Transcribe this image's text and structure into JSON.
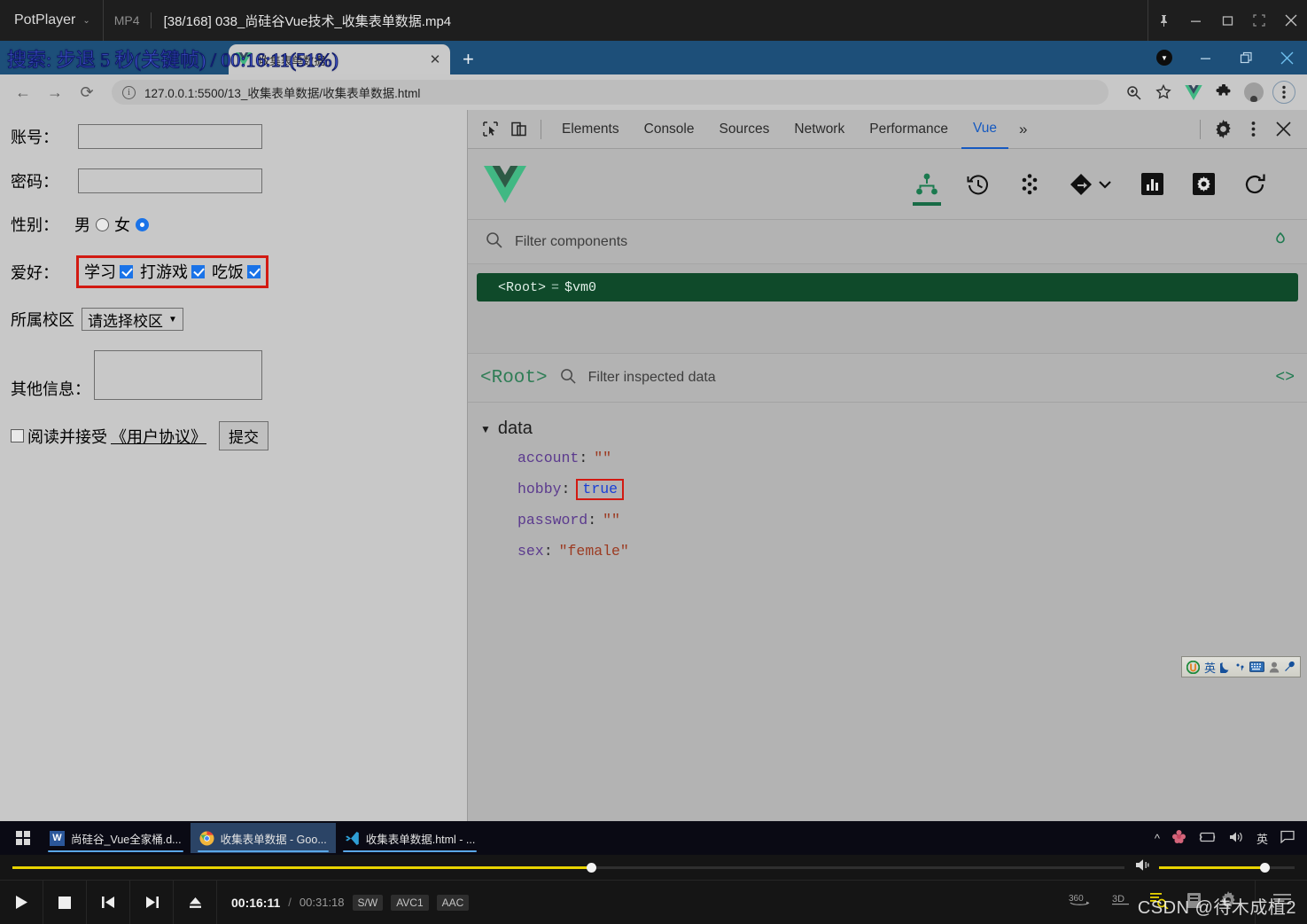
{
  "potplayer": {
    "brand": "PotPlayer",
    "format": "MP4",
    "title": "[38/168] 038_尚硅谷Vue技术_收集表单数据.mp4",
    "window_buttons": [
      "pin",
      "minimize",
      "maximize",
      "fullscreen",
      "close"
    ],
    "osd_text": "搜索: 步退 5 秒(关键帧) / 00:16:11(51%)",
    "controls": {
      "current_time": "00:16:11",
      "separator": "/",
      "total_time": "00:31:18",
      "badges": [
        "S/W",
        "AVC1",
        "AAC"
      ],
      "seek_percent": 51,
      "volume_percent": 78,
      "buttons": [
        "play",
        "stop",
        "previous",
        "next",
        "eject"
      ],
      "right_buttons": [
        "360",
        "3D",
        "playlist-search",
        "bookmark",
        "settings",
        "menu"
      ]
    },
    "watermark": "CSDN @待木成植2"
  },
  "browser": {
    "tab": {
      "title": "收集表单数据",
      "close_label": "✕",
      "new_tab_label": "+"
    },
    "window_buttons": [
      "minimize",
      "restore",
      "close"
    ],
    "toolbar": {
      "back": "←",
      "forward": "→",
      "reload": "⟳",
      "url": "127.0.0.1:5500/13_收集表单数据/收集表单数据.html",
      "info_glyph": "i",
      "zoom_icon": "zoom-in-icon",
      "bookmark_icon": "star-icon",
      "vue_extension": "vue-extension-icon",
      "extensions_icon": "puzzle-icon",
      "profile_icon": "avatar-icon",
      "menu_icon": "kebab-menu-icon"
    }
  },
  "page": {
    "fields": {
      "account_label": "账号：",
      "account_value": "",
      "password_label": "密码：",
      "password_value": "",
      "sex_label": "性别：",
      "sex_male": "男",
      "sex_female": "女",
      "sex_selected": "女",
      "hobby_label": "爱好：",
      "hobby_items": [
        {
          "label": "学习",
          "checked": true
        },
        {
          "label": "打游戏",
          "checked": true
        },
        {
          "label": "吃饭",
          "checked": true
        }
      ],
      "campus_label": "所属校区",
      "campus_selected": "请选择校区",
      "campus_caret": "▼",
      "other_label": "其他信息：",
      "other_value": "",
      "agree_prefix": "阅读并接受",
      "agree_link": "《用户协议》",
      "agree_checked": false,
      "submit_label": "提交"
    }
  },
  "devtools": {
    "tabs": [
      {
        "label": "Elements",
        "active": false
      },
      {
        "label": "Console",
        "active": false
      },
      {
        "label": "Sources",
        "active": false
      },
      {
        "label": "Network",
        "active": false
      },
      {
        "label": "Performance",
        "active": false
      },
      {
        "label": "Vue",
        "active": true
      }
    ],
    "overflow_label": "»",
    "left_icons": [
      "inspect-element-icon",
      "device-toolbar-icon"
    ],
    "right_icons": [
      "settings-gear-icon",
      "kebab-menu-icon",
      "close-icon"
    ],
    "vue": {
      "logo": "vue-logo",
      "tool_icons": [
        "component-tree-icon",
        "timeline-history-icon",
        "vuex-icon",
        "router-icon",
        "performance-icon",
        "settings-icon",
        "refresh-icon"
      ],
      "active_tool": "component-tree-icon",
      "filter_components_placeholder": "Filter components",
      "select_component_icon": "target-icon",
      "tree": [
        {
          "name": "<Root>",
          "equals": "=",
          "instance": "$vm0",
          "selected": true
        }
      ],
      "inspector": {
        "component_name": "<Root>",
        "filter_placeholder": "Filter inspected data",
        "open_in_editor_icon": "code-icon",
        "section": "data",
        "section_expanded": true,
        "entries": [
          {
            "key": "account",
            "value": "\"\"",
            "type": "string",
            "highlight": false
          },
          {
            "key": "hobby",
            "value": "true",
            "type": "boolean",
            "highlight": true
          },
          {
            "key": "password",
            "value": "\"\"",
            "type": "string",
            "highlight": false
          },
          {
            "key": "sex",
            "value": "\"female\"",
            "type": "string",
            "highlight": false
          }
        ]
      }
    }
  },
  "ime": {
    "icons": [
      "sogou-logo-icon",
      "keyboard-icon",
      "user-icon",
      "wrench-icon"
    ],
    "mode": "英",
    "moon_icon": "moon-icon",
    "punctuation_icon": "punctuation-icon"
  },
  "taskbar": {
    "start_icon": "windows-start-icon",
    "items": [
      {
        "label": "尚硅谷_Vue全家桶.d...",
        "icon": "word-icon",
        "icon_glyph": "W",
        "icon_color": "#2b579a",
        "active": false
      },
      {
        "label": "收集表单数据 - Goo...",
        "icon": "chrome-icon",
        "icon_glyph": "◉",
        "icon_color": "#e8a33d",
        "active": true
      },
      {
        "label": "收集表单数据.html - ...",
        "icon": "vscode-icon",
        "icon_glyph": "◀",
        "icon_color": "#2f9fd6",
        "active": false
      }
    ],
    "tray": {
      "chevron": "^",
      "icons": [
        "flower-icon",
        "battery-icon",
        "volume-icon"
      ],
      "ime_label": "英",
      "notification_icon": "notification-icon"
    }
  },
  "colors": {
    "accent_blue": "#1a73e8",
    "highlight_red": "#d21a12",
    "vue_green": "#186b46",
    "seek_yellow": "#e8d300",
    "devtools_active_tab": "#1559c0"
  }
}
